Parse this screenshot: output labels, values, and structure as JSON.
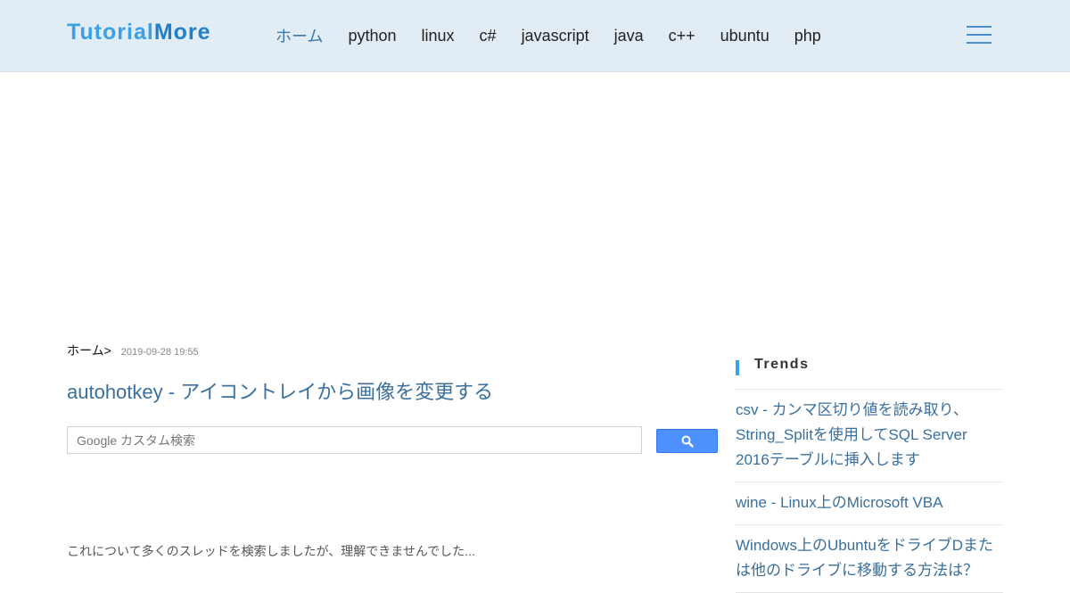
{
  "header": {
    "logo": {
      "part1": "Tutorial",
      "part2": "More"
    },
    "nav": [
      {
        "label": "ホーム",
        "active": true
      },
      {
        "label": "python"
      },
      {
        "label": "linux"
      },
      {
        "label": "c#"
      },
      {
        "label": "javascript"
      },
      {
        "label": "java"
      },
      {
        "label": "c++"
      },
      {
        "label": "ubuntu"
      },
      {
        "label": "php"
      }
    ],
    "menu_icon": "hamburger-menu-icon"
  },
  "breadcrumb": {
    "home": "ホーム>",
    "date": "2019-09-28 19:55"
  },
  "article": {
    "title": "autohotkey - アイコントレイから画像を変更する",
    "lead": "これについて多くのスレッドを検索しましたが、理解できませんでした..."
  },
  "search": {
    "placeholder": "Google カスタム検索",
    "value": "",
    "button_icon": "search-icon"
  },
  "sidebar": {
    "heading": "Trends",
    "items": [
      {
        "label": "csv - カンマ区切り値を読み取り、String_Splitを使用してSQL Server 2016テーブルに挿入します"
      },
      {
        "label": "wine - Linux上のMicrosoft VBA"
      },
      {
        "label": "Windows上のUbuntuをドライブDまたは他のドライブに移動する方法は？"
      }
    ]
  },
  "colors": {
    "header_bg": "#e2ecf5",
    "logo_light": "#3aa1e6",
    "logo_dark": "#1f7fc9",
    "link": "#3a6f9e",
    "search_button": "#4d90fe"
  }
}
